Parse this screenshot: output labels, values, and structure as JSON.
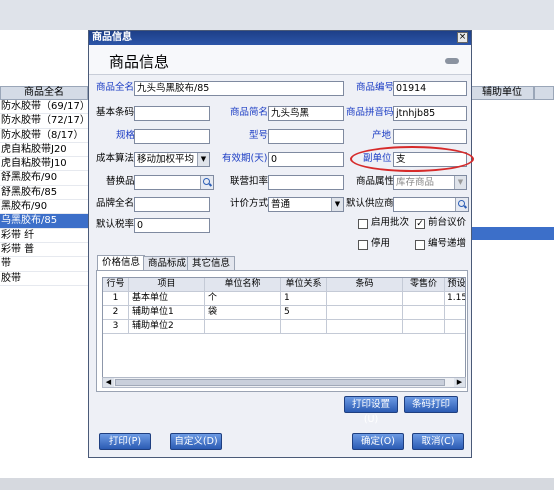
{
  "background": {
    "headers": {
      "full_name": "商品全名",
      "aux_unit": "辅助单位"
    },
    "rows": [
      "防水胶带（69/17）",
      "防水胶带（72/17）",
      "防水胶带（8/17）",
      "虎自粘胶带J20",
      "虎自粘胶带J10",
      "舒黑胶布/90",
      "舒黑胶布/85",
      "黑胶布/90",
      "乌黑胶布/85",
      "彩带 纤",
      "彩带 普",
      "带",
      "胶带"
    ]
  },
  "dialog": {
    "window_title": "商品信息",
    "heading": "商品信息",
    "labels": {
      "full_name": "商品全名",
      "code": "商品编号",
      "barcode": "基本条码",
      "short_name": "商品简名",
      "pinyin": "商品拼音码",
      "spec": "规格",
      "model": "型号",
      "origin": "产地",
      "cost_method": "成本算法",
      "validity": "有效期(天)",
      "aux_unit": "副单位",
      "substitute": "替换品",
      "linked_discount": "联营扣率",
      "attribute": "商品属性",
      "brand": "品牌全名",
      "pricing_method": "计价方式",
      "default_supplier": "默认供应商",
      "default_tax": "默认税率",
      "batch": "启用批次",
      "front_price": "前台议价",
      "disabled": "停用",
      "code_increment": "编号递增"
    },
    "values": {
      "full_name": "九头鸟黑胶布/85",
      "code": "01914",
      "barcode": "",
      "short_name": "九头鸟黑",
      "pinyin": "jtnhjb85",
      "spec": "",
      "model": "",
      "origin": "",
      "cost_method": "移动加权平均",
      "validity": "0",
      "aux_unit": "支",
      "substitute": "",
      "linked_discount": "",
      "attribute": "库存商品",
      "brand": "",
      "pricing_method": "普通",
      "default_supplier": "",
      "default_tax": "0"
    },
    "checkboxes": {
      "batch": false,
      "front_price": true,
      "disabled": false,
      "code_increment": false
    },
    "tabs": [
      "价格信息",
      "商品标成",
      "其它信息"
    ],
    "grid": {
      "headers": [
        "行号",
        "项目",
        "单位名称",
        "单位关系",
        "条码",
        "零售价",
        "预设"
      ],
      "rows": [
        {
          "no": "1",
          "item": "基本单位",
          "unit": "个",
          "ratio": "1",
          "barcode": "",
          "retail": "",
          "preset": "1.15"
        },
        {
          "no": "2",
          "item": "辅助单位1",
          "unit": "袋",
          "ratio": "5",
          "barcode": "",
          "retail": "",
          "preset": ""
        },
        {
          "no": "3",
          "item": "辅助单位2",
          "unit": "",
          "ratio": "",
          "barcode": "",
          "retail": "",
          "preset": ""
        }
      ]
    },
    "buttons": {
      "print_settings": "打印设置(U)",
      "barcode_print": "条码打印",
      "print": "打印(P)",
      "customize": "自定义(D)",
      "ok": "确定(O)",
      "cancel": "取消(C)"
    },
    "icons": {
      "close": "×",
      "search": "search-icon",
      "dropdown": "▼",
      "check": "✓"
    }
  }
}
